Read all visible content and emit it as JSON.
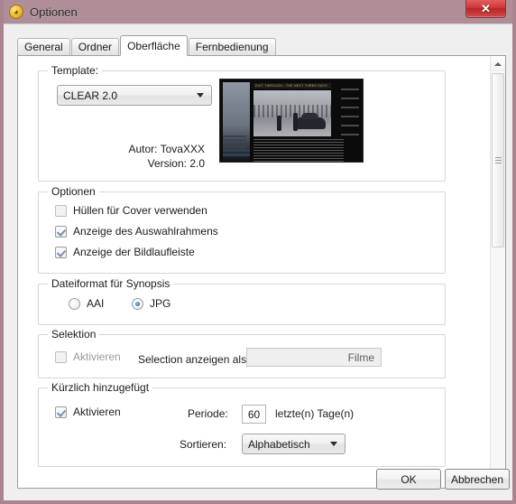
{
  "window": {
    "title": "Optionen",
    "icon": "app-icon",
    "close_label": "✕"
  },
  "tabs": [
    {
      "label": "General",
      "active": false
    },
    {
      "label": "Ordner",
      "active": false
    },
    {
      "label": "Oberfläche",
      "active": true
    },
    {
      "label": "Fernbedienung",
      "active": false
    }
  ],
  "template_group": {
    "title": "Template:",
    "combo_value": "CLEAR 2.0",
    "autor": "Autor: TovaXXX",
    "version": "Version: 2.0",
    "preview_caption": "EXIT THROUGH - THE NEXT THREE DAYS"
  },
  "optionen_group": {
    "title": "Optionen",
    "items": [
      {
        "label": "Hüllen für Cover verwenden",
        "checked": false
      },
      {
        "label": "Anzeige des Auswahlrahmens",
        "checked": true
      },
      {
        "label": "Anzeige der Bildlaufleiste",
        "checked": true
      }
    ]
  },
  "synopsis_group": {
    "title": "Dateiformat für Synopsis",
    "options": [
      {
        "label": "AAI",
        "selected": false
      },
      {
        "label": "JPG",
        "selected": true
      }
    ]
  },
  "selektion_group": {
    "title": "Selektion",
    "activate_label": "Aktivieren",
    "activate_checked": false,
    "display_as_label": "Selection anzeigen als:",
    "display_as_value": "Filme"
  },
  "recent_group": {
    "title": "Kürzlich hinzugefügt",
    "activate_label": "Aktivieren",
    "activate_checked": true,
    "period_label": "Periode:",
    "period_value": "60",
    "period_suffix": "letzte(n) Tage(n)",
    "sort_label": "Sortieren:",
    "sort_value": "Alphabetisch"
  },
  "footer": {
    "ok_label": "OK",
    "cancel_label": "Abbrechen"
  },
  "colors": {
    "titlebar": "#a8858f",
    "close_button": "#cf3535",
    "accent_radio": "#1a7fc0",
    "checkmark": "#7a93ab",
    "page_background": "#ffffff",
    "dialog_background": "#efefef"
  }
}
